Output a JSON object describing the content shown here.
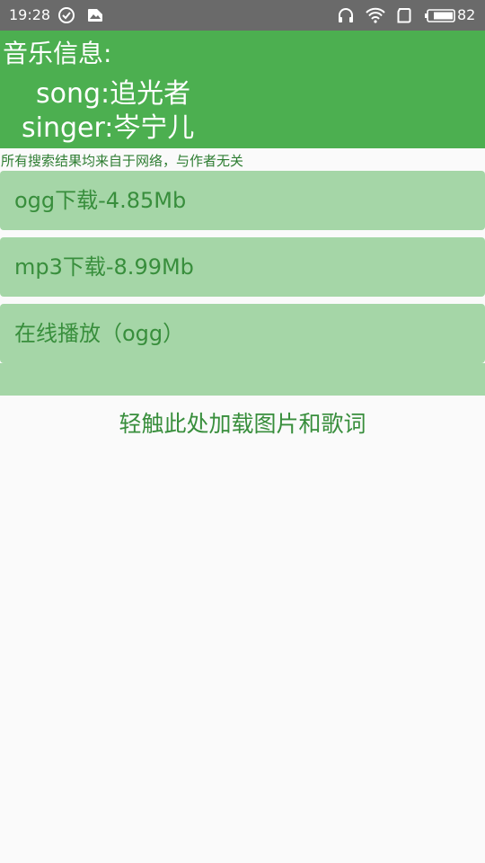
{
  "status_bar": {
    "time": "19:28",
    "battery": "82",
    "icons": [
      "check-circle-icon",
      "image-notification-icon",
      "headphones-icon",
      "wifi-icon",
      "sim-icon",
      "battery-icon"
    ]
  },
  "header": {
    "title": "音乐信息:",
    "song_label": "song:",
    "song_value": "追光者",
    "singer_label": "singer:",
    "singer_value": "岑宁儿"
  },
  "disclaimer": "所有搜索结果均来自于网络，与作者无关",
  "downloads": {
    "ogg": "ogg下载-4.85Mb",
    "mp3": "mp3下载-8.99Mb",
    "play": "在线播放（ogg）"
  },
  "load_link": "轻触此处加载图片和歌词",
  "colors": {
    "header_bg": "#4caf50",
    "button_bg": "#a5d6a7",
    "text_green": "#388e3c",
    "status_bar_bg": "#6a6a6a"
  }
}
